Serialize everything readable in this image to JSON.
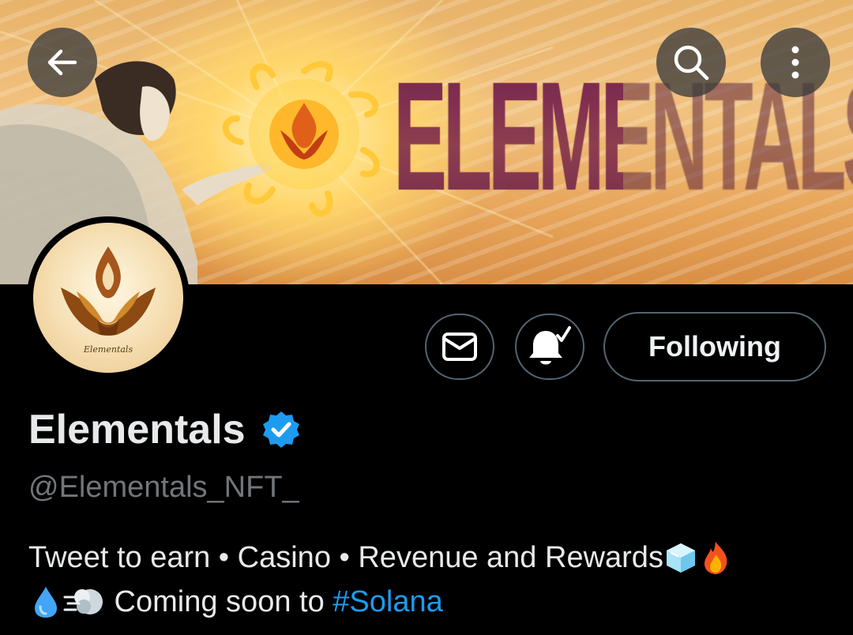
{
  "banner": {
    "title_art": "ELEMENTALS"
  },
  "header": {
    "back_icon": "arrow-left-icon",
    "search_icon": "search-icon",
    "more_icon": "more-vertical-icon"
  },
  "avatar": {
    "caption": "Elementals"
  },
  "actions": {
    "message_icon": "mail-icon",
    "notify_icon": "bell-check-icon",
    "follow_label": "Following"
  },
  "profile": {
    "name": "Elementals",
    "verified_icon": "verified-badge-icon",
    "handle": "@Elementals_NFT_",
    "bio_line1": "Tweet to earn • Casino • Revenue and Rewards",
    "bio_line1_emojis": [
      "ice-cube-emoji",
      "fire-emoji"
    ],
    "bio_line2_emojis": [
      "droplet-emoji",
      "wind-face-emoji"
    ],
    "bio_line2_text": " Coming soon to ",
    "bio_hashtag": "#Solana"
  },
  "colors": {
    "background": "#000000",
    "text_primary": "#e7e9ea",
    "text_secondary": "#71767b",
    "accent_blue": "#1d9bf0",
    "button_border": "#536471"
  }
}
